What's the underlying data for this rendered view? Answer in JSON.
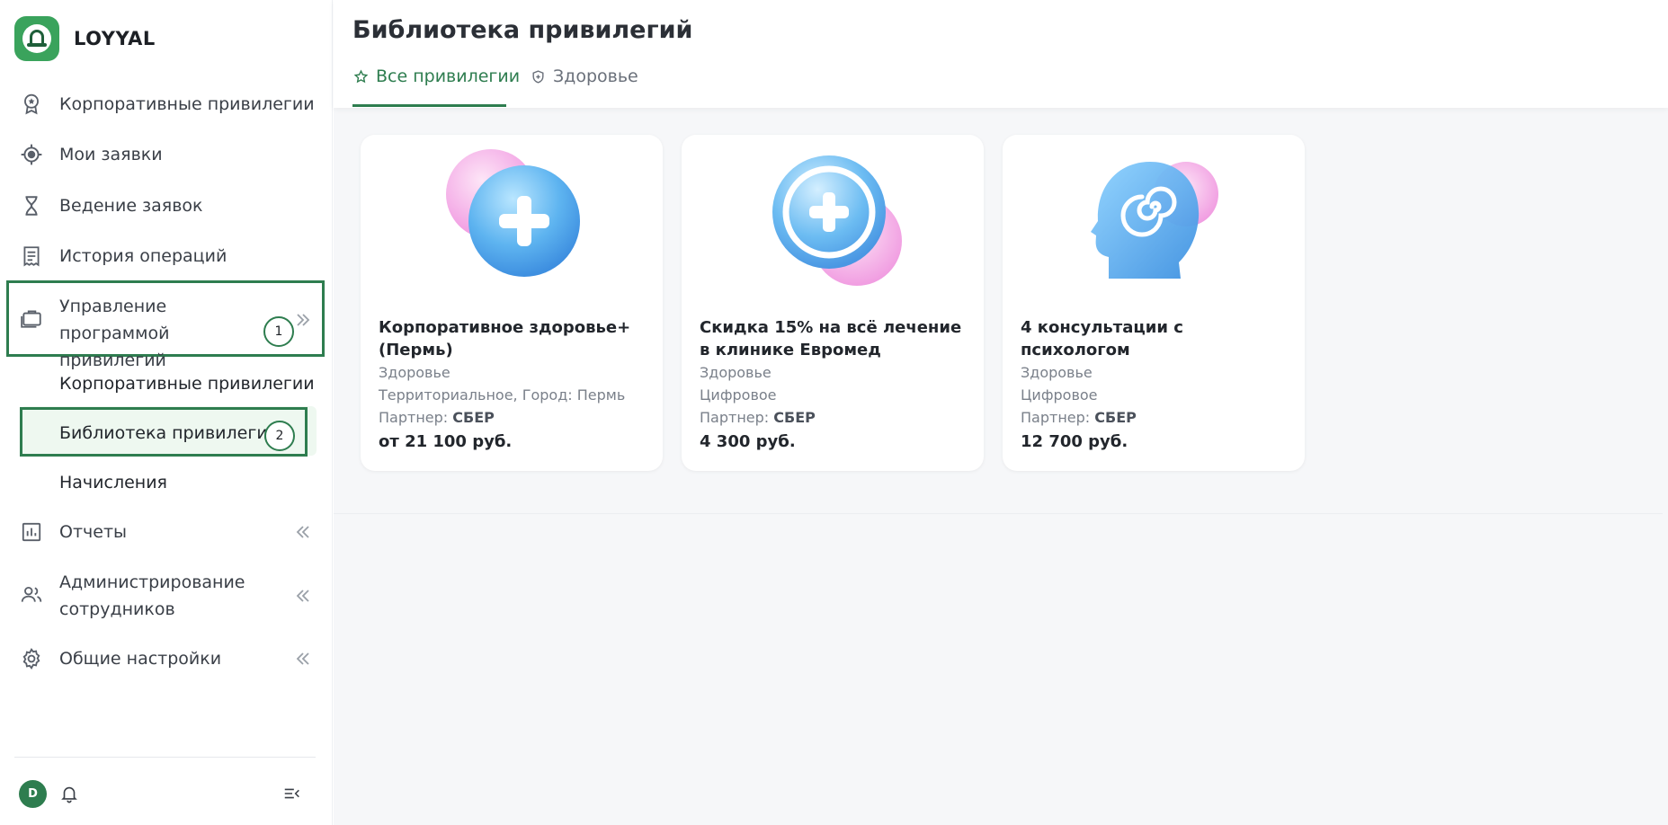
{
  "app": {
    "name": "LOYYAL"
  },
  "sidebar": {
    "items": [
      {
        "label": "Корпоративные привилегии",
        "icon": "badge-star-icon"
      },
      {
        "label": "Мои заявки",
        "icon": "target-icon"
      },
      {
        "label": "Ведение заявок",
        "icon": "hourglass-icon"
      },
      {
        "label": "История операций",
        "icon": "receipt-icon"
      },
      {
        "label": "Управление программой привилегий",
        "icon": "briefcase-icon"
      }
    ],
    "subitems": [
      {
        "label": "Корпоративные привилегии"
      },
      {
        "label": "Библиотека привилегий",
        "active": true
      },
      {
        "label": "Начисления"
      }
    ],
    "bottom_items": [
      {
        "label": "Отчеты",
        "icon": "chart-icon"
      },
      {
        "label": "Администрирование сотрудников",
        "icon": "users-icon"
      },
      {
        "label": "Общие настройки",
        "icon": "gear-icon"
      }
    ],
    "annotations": {
      "first": "1",
      "second": "2"
    },
    "footer": {
      "avatar": "D"
    }
  },
  "header": {
    "title": "Библиотека привилегий",
    "tabs": [
      {
        "label": "Все привилегии",
        "icon": "star-icon",
        "active": true
      },
      {
        "label": "Здоровье",
        "icon": "shield-icon"
      }
    ]
  },
  "cards": [
    {
      "title": "Корпоративное здоровье+ (Пермь)",
      "category": "Здоровье",
      "type": "Территориальное, Город: Пермь",
      "partner_label": "Партнер:",
      "partner": "СБЕР",
      "price": "от 21 100 руб.",
      "image": "medical-plus-bubble-icon"
    },
    {
      "title": "Скидка 15% на всё лечение в клинике Евромед",
      "category": "Здоровье",
      "type": "Цифровое",
      "partner_label": "Партнер:",
      "partner": "СБЕР",
      "price": "4 300 руб.",
      "image": "medical-plus-circle-icon"
    },
    {
      "title": "4 консультации с психологом",
      "category": "Здоровье",
      "type": "Цифровое",
      "partner_label": "Партнер:",
      "partner": "СБЕР",
      "price": "12 700 руб.",
      "image": "head-spiral-icon"
    }
  ],
  "colors": {
    "accent": "#2e7d4f",
    "brand": "#3aa35c",
    "background": "#f6f7f9"
  }
}
